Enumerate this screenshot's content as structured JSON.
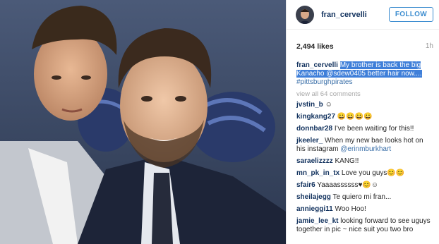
{
  "post": {
    "username": "fran_cervelli",
    "follow_label": "FOLLOW",
    "likes": "2,494 likes",
    "time_ago": "1h",
    "caption": {
      "user": "fran_cervelli",
      "highlighted_text": "My brother is back the big Kanacho @sdew0405 better hair now....",
      "hashtag": "#pittsburghpirates"
    },
    "view_all": "view all 64 comments"
  },
  "comments": [
    {
      "user": "jvstin_b",
      "text": "☺"
    },
    {
      "user": "kingkang27",
      "text": "😀😀😀😀"
    },
    {
      "user": "donnbar28",
      "text": "I've been waiting for this!!"
    },
    {
      "user": "jkeeler_",
      "text": "When my new bae looks hot on his instagram",
      "mention": "@erinmburkhart"
    },
    {
      "user": "saraelizzzz",
      "text": "KANG!!"
    },
    {
      "user": "mn_pk_in_tx",
      "text": "Love you guys😊😊"
    },
    {
      "user": "sfair6",
      "text": "Yaaaassssss♥😊☺"
    },
    {
      "user": "sheilajegg",
      "text": "Te quiero mi fran..."
    },
    {
      "user": "annieggi11",
      "text": "Woo Hoo!"
    },
    {
      "user": "jamie_lee_kt",
      "text": "looking forward to see uguys together in pic ~ nice suit you two bro"
    }
  ],
  "colors": {
    "accent": "#3e8ed0",
    "username": "#12325e",
    "selection": "#3f7fd9"
  }
}
